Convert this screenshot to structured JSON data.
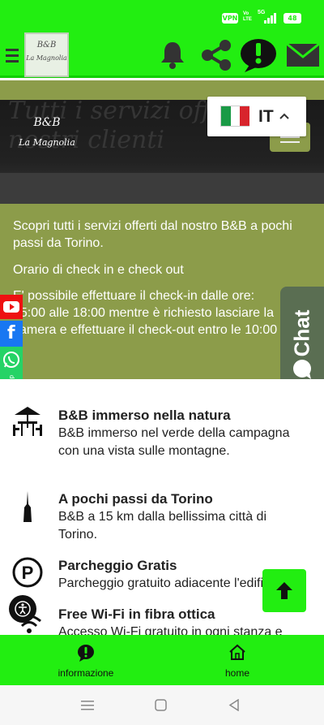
{
  "status_bar": {
    "vpn": "VPN",
    "volte": "Vo LTE",
    "network": "5G",
    "battery": "48"
  },
  "app_bar": {
    "logo_line1": "B&B",
    "logo_line2": "La Magnolia"
  },
  "hero": {
    "logo_line1": "B&B",
    "logo_line2": "La Magnolia",
    "bg_text": "Tutti i servizi offerti ai nostri clienti"
  },
  "language": {
    "code": "IT"
  },
  "intro": {
    "line1": "Scopri tutti i servizi offerti dal nostro B&B a pochi passi da Torino.",
    "line2": "Orario di check in e check out",
    "line3": "E' possibile effettuare il check-in dalle ore: 15:00 alle 18:00 mentre è richiesto lasciare la camera e effettuare il check-out  entro le 10:00"
  },
  "chat_tab": {
    "label": "Chat"
  },
  "social": {
    "whatsapp_label": "WhatsApp"
  },
  "features": [
    {
      "title": "B&B immerso nella natura",
      "desc": "B&B immerso nel verde della campagna con una vista sulle montagne."
    },
    {
      "title": "A pochi passi da Torino",
      "desc": "B&B a 15 km dalla bellissima città di Torino."
    },
    {
      "title": "Parcheggio Gratis",
      "desc": "Parcheggio gratuito adiacente l'edificio."
    },
    {
      "title": "Free Wi-Fi in fibra ottica",
      "desc": "Accesso Wi-Fi gratuito in ogni stanza e"
    }
  ],
  "bottom_nav": [
    {
      "label": "informazione"
    },
    {
      "label": "home"
    }
  ],
  "colors": {
    "brand_green": "#22ee11",
    "olive": "#8c9c4a",
    "chat_tab": "#5a6e52"
  }
}
